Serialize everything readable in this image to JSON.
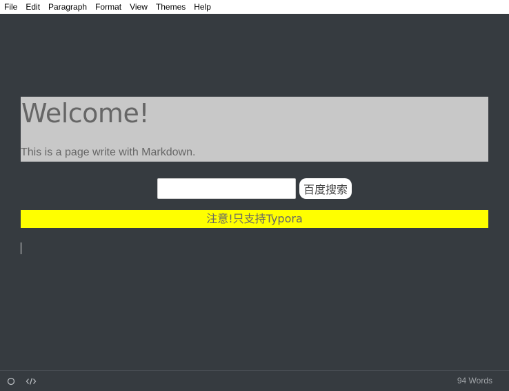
{
  "menubar": {
    "items": [
      "File",
      "Edit",
      "Paragraph",
      "Format",
      "View",
      "Themes",
      "Help"
    ]
  },
  "document": {
    "title": "Welcome!",
    "intro": "This is a page write with Markdown.",
    "search": {
      "input_value": "",
      "button_label": "百度搜索"
    },
    "notice": "注意!只支持Typora"
  },
  "footer": {
    "word_count": "94 Words",
    "icons": [
      "circle-icon",
      "code-icon"
    ]
  },
  "colors": {
    "background": "#363b40",
    "welcome_block": "#c8c8c8",
    "notice_bar": "#ffff00",
    "text_gray": "#666666"
  }
}
